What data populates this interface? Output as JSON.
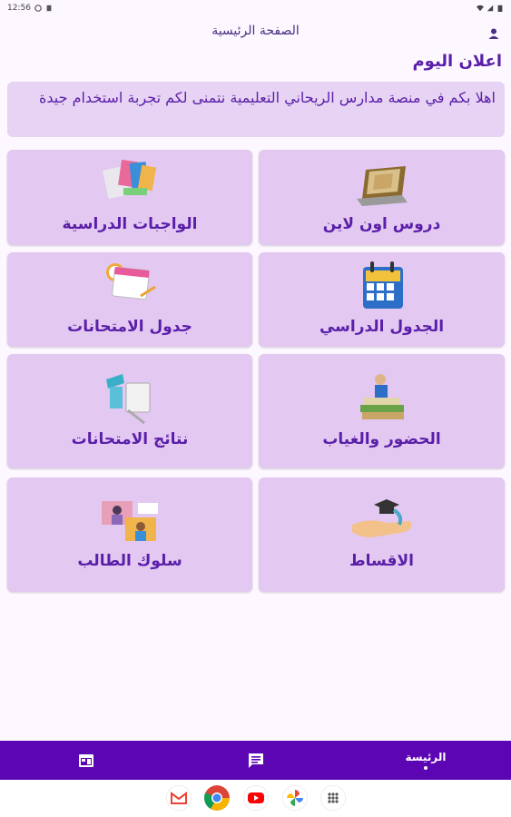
{
  "status_bar": {
    "time": "12:56"
  },
  "header": {
    "title": "الصفحة الرئيسية"
  },
  "announcement": {
    "title": "اعلان اليوم",
    "text": "اهلا بكم في منصة مدارس الريحاني التعليمية نتمنى لكم تجربة استخدام جيدة"
  },
  "tiles": [
    {
      "label": "دروس اون لاين",
      "icon": "laptop-book-icon"
    },
    {
      "label": "الواجبات الدراسية",
      "icon": "homework-books-icon"
    },
    {
      "label": "الجدول الدراسي",
      "icon": "calendar-icon"
    },
    {
      "label": "جدول الامتحانات",
      "icon": "exam-calendar-icon"
    },
    {
      "label": "الحضور والغياب",
      "icon": "student-on-books-icon"
    },
    {
      "label": "نتائج الامتحانات",
      "icon": "exam-results-icon"
    },
    {
      "label": "الاقساط",
      "icon": "graduation-fees-icon"
    },
    {
      "label": "سلوك الطالب",
      "icon": "student-video-icon"
    }
  ],
  "bottom_nav": {
    "home_label": "الرئيسة",
    "items": [
      "home",
      "chat-icon",
      "calendar-icon"
    ]
  },
  "dock": [
    "gmail-icon",
    "chrome-icon",
    "youtube-icon",
    "photos-icon",
    "apps-grid-icon"
  ],
  "colors": {
    "accent": "#5c05b3",
    "tile": "#e3c8f1",
    "text": "#5a1fa8"
  }
}
